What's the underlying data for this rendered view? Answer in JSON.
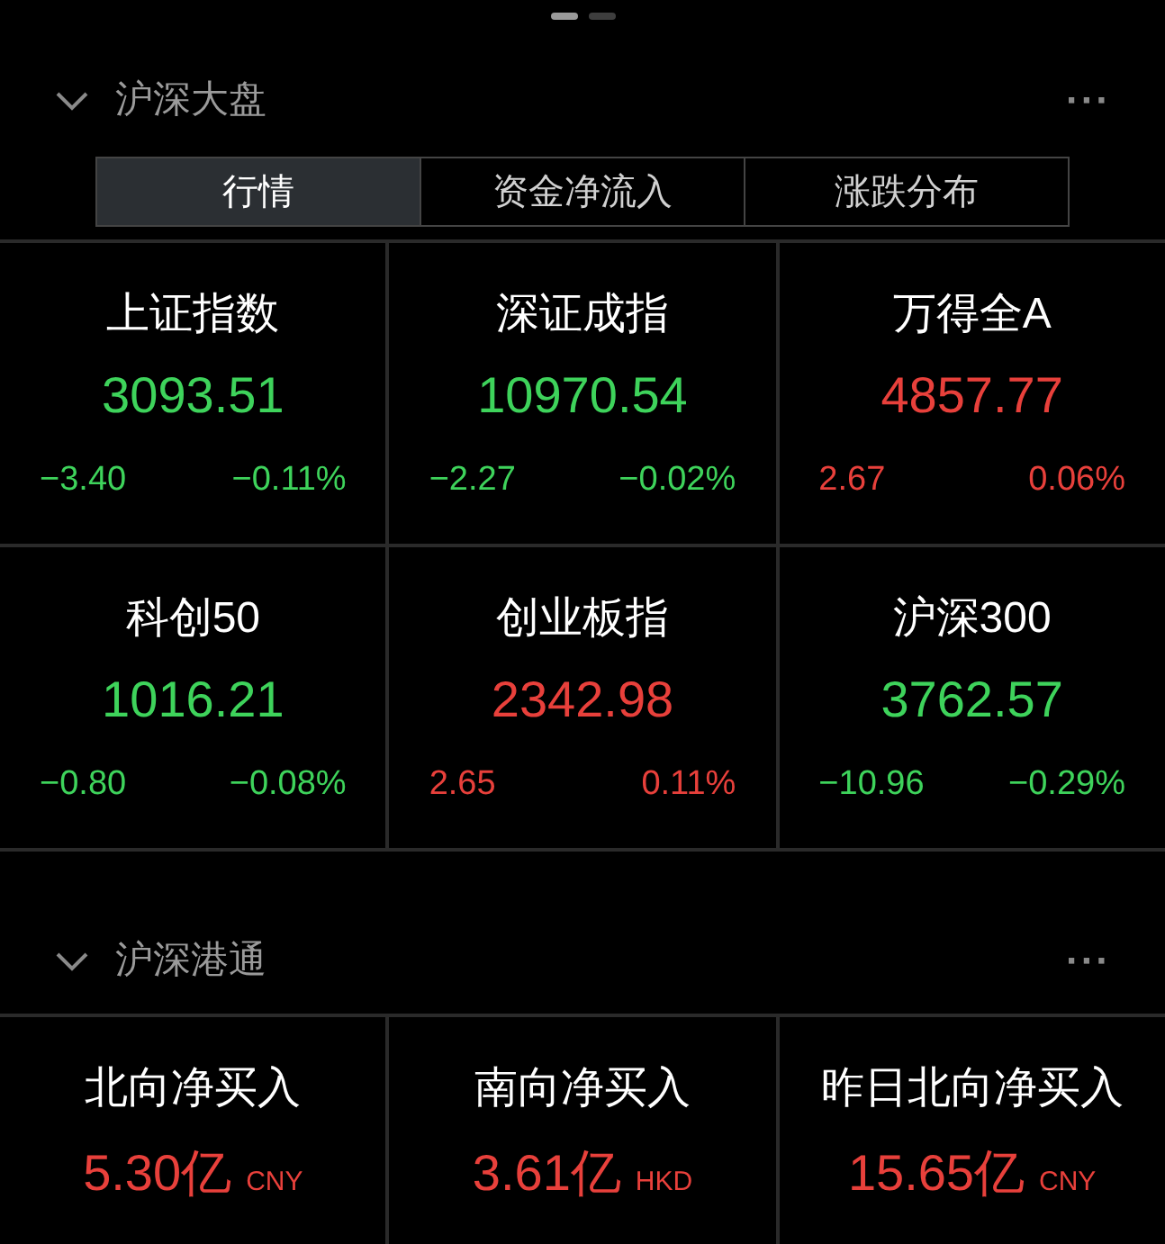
{
  "pager": [
    {
      "selected": true
    },
    {
      "selected": false
    }
  ],
  "market": {
    "title": "沪深大盘",
    "more": "···",
    "tabs": [
      {
        "label": "行情",
        "selected": true
      },
      {
        "label": "资金净流入",
        "selected": false
      },
      {
        "label": "涨跌分布",
        "selected": false
      }
    ],
    "indices": [
      {
        "name": "上证指数",
        "value": "3093.51",
        "change": "−3.40",
        "pct": "−0.11%",
        "color": "#3ed35b"
      },
      {
        "name": "深证成指",
        "value": "10970.54",
        "change": "−2.27",
        "pct": "−0.02%",
        "color": "#3ed35b"
      },
      {
        "name": "万得全A",
        "value": "4857.77",
        "change": "2.67",
        "pct": "0.06%",
        "color": "#e8403b"
      },
      {
        "name": "科创50",
        "value": "1016.21",
        "change": "−0.80",
        "pct": "−0.08%",
        "color": "#3ed35b"
      },
      {
        "name": "创业板指",
        "value": "2342.98",
        "change": "2.65",
        "pct": "0.11%",
        "color": "#e8403b"
      },
      {
        "name": "沪深300",
        "value": "3762.57",
        "change": "−10.96",
        "pct": "−0.29%",
        "color": "#3ed35b"
      }
    ]
  },
  "connect": {
    "title": "沪深港通",
    "more": "···",
    "flows": [
      {
        "name": "北向净买入",
        "value": "5.30亿",
        "unit": "CNY",
        "color": "#e8403b"
      },
      {
        "name": "南向净买入",
        "value": "3.61亿",
        "unit": "HKD",
        "color": "#e8403b"
      },
      {
        "name": "昨日北向净买入",
        "value": "15.65亿",
        "unit": "CNY",
        "color": "#e8403b"
      }
    ]
  }
}
